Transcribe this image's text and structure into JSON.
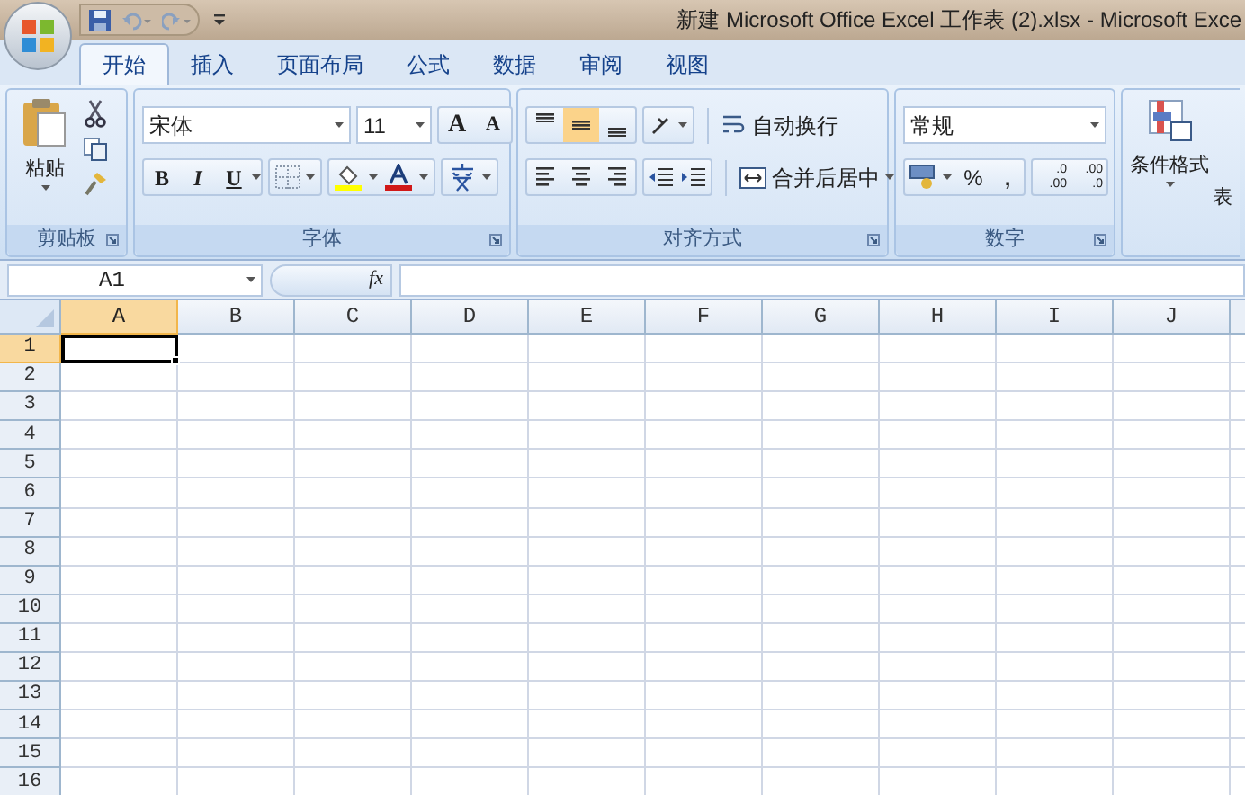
{
  "title_bar": {
    "title": "新建 Microsoft Office Excel 工作表 (2).xlsx - Microsoft Exce"
  },
  "tabs": [
    {
      "label": "开始",
      "selected": true
    },
    {
      "label": "插入",
      "selected": false
    },
    {
      "label": "页面布局",
      "selected": false
    },
    {
      "label": "公式",
      "selected": false
    },
    {
      "label": "数据",
      "selected": false
    },
    {
      "label": "审阅",
      "selected": false
    },
    {
      "label": "视图",
      "selected": false
    }
  ],
  "clipboard": {
    "label": "剪贴板",
    "paste": "粘贴"
  },
  "font": {
    "label": "字体",
    "font_name": "宋体",
    "font_size": "11",
    "grow": "A",
    "shrink": "A",
    "bold": "B",
    "italic": "I",
    "underline": "U"
  },
  "alignment": {
    "label": "对齐方式",
    "vertical": [
      {
        "kind": "top",
        "selected": false
      },
      {
        "kind": "middle",
        "selected": true
      },
      {
        "kind": "bottom",
        "selected": false
      }
    ],
    "horizontal": [
      {
        "kind": "left",
        "selected": false
      },
      {
        "kind": "center",
        "selected": false
      },
      {
        "kind": "right",
        "selected": false
      }
    ],
    "wrap_text": "自动换行",
    "merge_center": "合并后居中"
  },
  "number": {
    "label": "数字",
    "format": "常规",
    "percent": "%",
    "comma": ",",
    "increase_decimal": [
      ".0",
      ".00"
    ],
    "decrease_decimal": [
      ".00",
      ".0"
    ]
  },
  "styles": {
    "conditional_formatting": "条件格式",
    "table": "表"
  },
  "formula_bar": {
    "name_box": "A1",
    "fx": "fx"
  },
  "sheet": {
    "columns": [
      {
        "label": "A",
        "selected": true
      },
      {
        "label": "B",
        "selected": false
      },
      {
        "label": "C",
        "selected": false
      },
      {
        "label": "D",
        "selected": false
      },
      {
        "label": "E",
        "selected": false
      },
      {
        "label": "F",
        "selected": false
      },
      {
        "label": "G",
        "selected": false
      },
      {
        "label": "H",
        "selected": false
      },
      {
        "label": "I",
        "selected": false
      },
      {
        "label": "J",
        "selected": false
      }
    ],
    "rows": [
      {
        "label": "1",
        "selected": true
      },
      {
        "label": "2",
        "selected": false
      },
      {
        "label": "3",
        "selected": false
      },
      {
        "label": "4",
        "selected": false
      },
      {
        "label": "5",
        "selected": false
      },
      {
        "label": "6",
        "selected": false
      },
      {
        "label": "7",
        "selected": false
      },
      {
        "label": "8",
        "selected": false
      },
      {
        "label": "9",
        "selected": false
      },
      {
        "label": "10",
        "selected": false
      },
      {
        "label": "11",
        "selected": false
      },
      {
        "label": "12",
        "selected": false
      },
      {
        "label": "13",
        "selected": false
      },
      {
        "label": "14",
        "selected": false
      },
      {
        "label": "15",
        "selected": false
      },
      {
        "label": "16",
        "selected": false
      }
    ]
  }
}
